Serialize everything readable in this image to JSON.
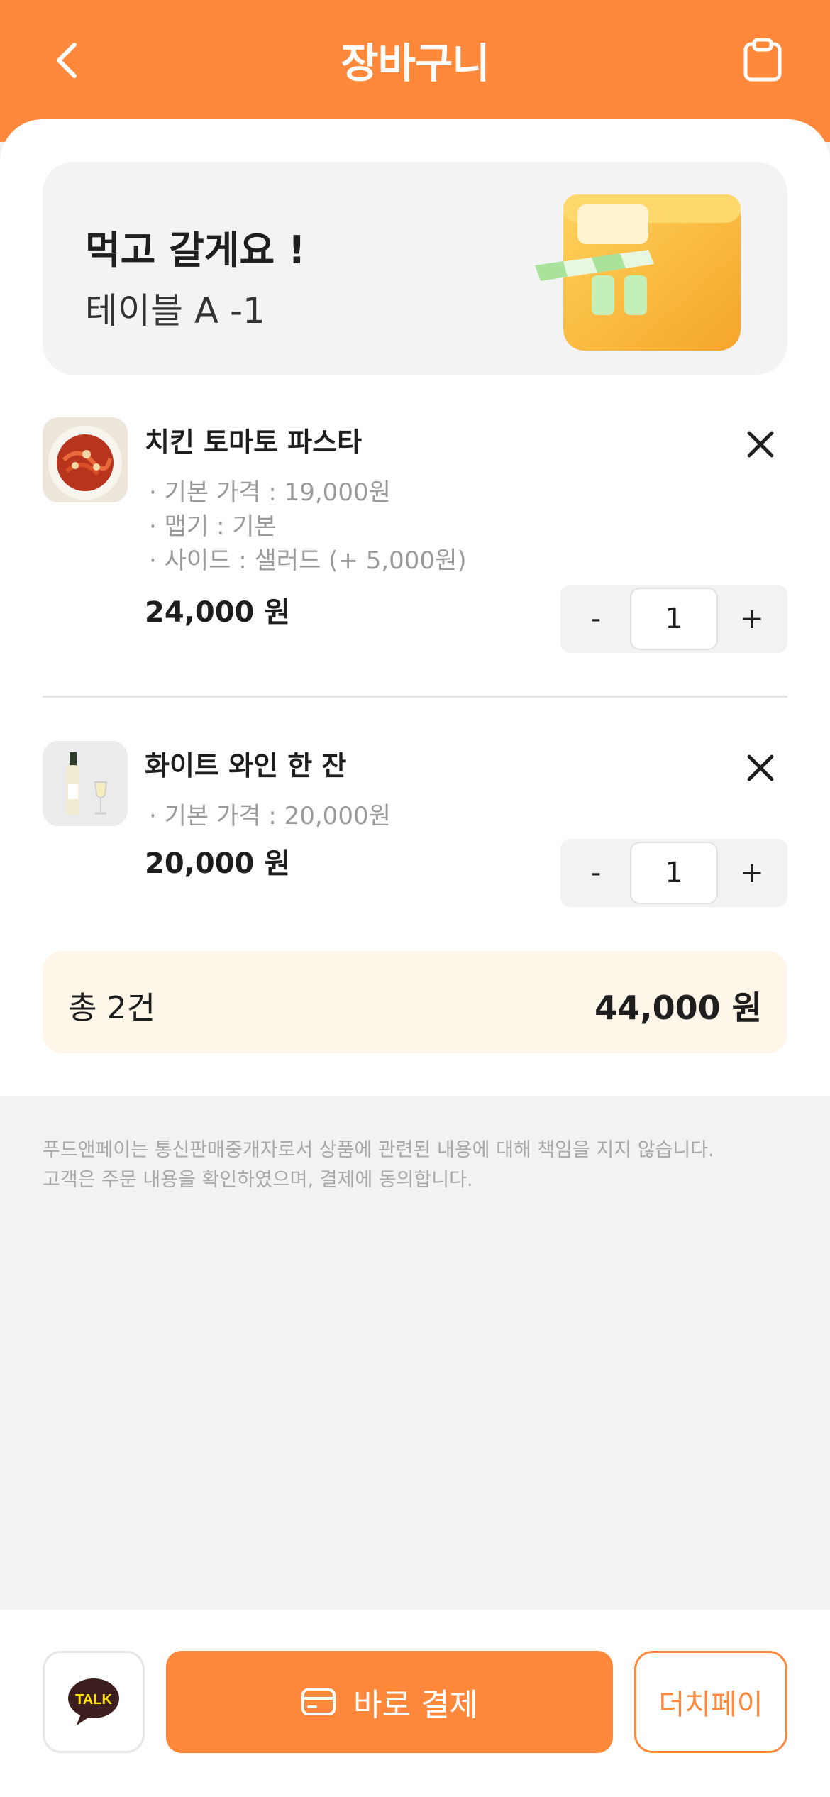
{
  "header": {
    "title": "장바구니",
    "back_icon": "chevron-left-icon",
    "receipt_icon": "clipboard-icon"
  },
  "store": {
    "mode": "먹고 갈게요 !",
    "table": "테이블  A -1",
    "illustration": "storefront-icon"
  },
  "cart": {
    "items": [
      {
        "name": "치킨 토마토 파스타",
        "options": [
          "· 기본 가격 : 19,000원",
          "· 맵기 : 기본",
          "· 사이드 : 샐러드 (+ 5,000원)"
        ],
        "price": "24,000 원",
        "quantity": "1",
        "image": "pasta-photo"
      },
      {
        "name": "화이트 와인 한 잔",
        "options": [
          "· 기본 가격 : 20,000원"
        ],
        "price": "20,000 원",
        "quantity": "1",
        "image": "wine-photo"
      }
    ],
    "minus_label": "-",
    "plus_label": "+"
  },
  "total": {
    "count": "총 2건",
    "amount": "44,000 원"
  },
  "notice": {
    "line1": "푸드앤페이는 통신판매중개자로서 상품에 관련된 내용에 대해 책임을 지지 않습니다.",
    "line2": "고객은 주문 내용을 확인하였으며, 결제에 동의합니다."
  },
  "bottom": {
    "talk_label": "TALK",
    "pay_label": "바로 결제",
    "dutch_label": "더치페이"
  },
  "colors": {
    "accent": "#FF883A",
    "total_bg": "#FFF6EA",
    "background": "#F2F2F2",
    "kakao": "#FFE100"
  }
}
